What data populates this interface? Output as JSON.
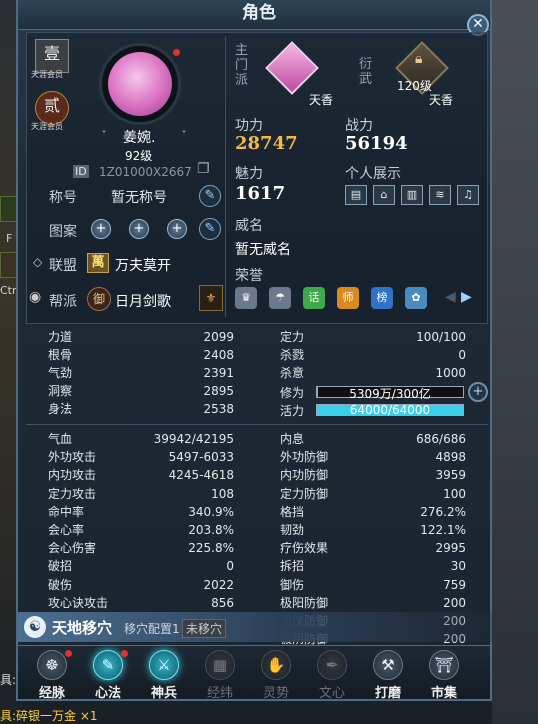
{
  "window": {
    "title": "角色"
  },
  "profile": {
    "seal1_glyph": "壹",
    "seal1_sub": "天涯会员",
    "seal2_glyph": "贰",
    "seal2_sub": "天涯会员",
    "name": "姜婉.",
    "level": "92级",
    "id_badge": "ID",
    "id": "1Z01000X2667"
  },
  "school": {
    "main_label": "主门派",
    "main_name": "天香",
    "yan_label": "衍武",
    "yan_level": "120级",
    "yan_name": "天香"
  },
  "summary": {
    "gongli_label": "功力",
    "gongli": "28747",
    "zhanli_label": "战力",
    "zhanli": "56194",
    "meili_label": "魅力",
    "meili": "1617",
    "showcase_label": "个人展示",
    "showcase_icons": [
      "id-card-icon",
      "house-icon",
      "palace-icon",
      "bird-icon",
      "bell-icon"
    ],
    "weiming_label": "威名",
    "weiming": "暂无威名",
    "rongyu_label": "荣誉",
    "honor_icons": [
      {
        "name": "hat-icon",
        "glyph": "♛",
        "color": "#6a7a8c"
      },
      {
        "name": "umbrella-icon",
        "glyph": "☂",
        "color": "#6a7a8c"
      },
      {
        "name": "hua-icon",
        "glyph": "话",
        "color": "#3ea84a"
      },
      {
        "name": "shi-icon",
        "glyph": "师",
        "color": "#d88a1e"
      },
      {
        "name": "bang-icon",
        "glyph": "榜",
        "color": "#2f72c8"
      },
      {
        "name": "flower-icon",
        "glyph": "✿",
        "color": "#4a8abf"
      }
    ]
  },
  "left_info": {
    "title_label": "称号",
    "title_value": "暂无称号",
    "pattern_label": "图案",
    "alliance_label": "联盟",
    "alliance_badge": "萬",
    "alliance_value": "万夫莫开",
    "guild_label": "帮派",
    "guild_badge": "御",
    "guild_value": "日月剑歌"
  },
  "stats_left_1": [
    {
      "label": "力道",
      "value": "2099"
    },
    {
      "label": "根骨",
      "value": "2408"
    },
    {
      "label": "气劲",
      "value": "2391"
    },
    {
      "label": "洞察",
      "value": "2895"
    },
    {
      "label": "身法",
      "value": "2538"
    }
  ],
  "stats_right_1": [
    {
      "label": "定力",
      "value": "100/100"
    },
    {
      "label": "杀戮",
      "value": "0"
    },
    {
      "label": "杀意",
      "value": "1000"
    }
  ],
  "bars": {
    "xiuwei_label": "修为",
    "xiuwei_text": "5309万/300亿",
    "xiuwei_fraction": 0.0018,
    "huoli_label": "活力",
    "huoli_text": "64000/64000",
    "huoli_fraction": 1.0
  },
  "stats_left_2": [
    {
      "label": "气血",
      "value": "39942/42195"
    },
    {
      "label": "外功攻击",
      "value": "5497-6033"
    },
    {
      "label": "内功攻击",
      "value": "4245-4618"
    },
    {
      "label": "定力攻击",
      "value": "108"
    },
    {
      "label": "命中率",
      "value": "340.9%"
    },
    {
      "label": "会心率",
      "value": "203.8%"
    },
    {
      "label": "会心伤害",
      "value": "225.8%"
    },
    {
      "label": "破招",
      "value": "0"
    },
    {
      "label": "破伤",
      "value": "2022"
    },
    {
      "label": "攻心诀攻击",
      "value": "856"
    }
  ],
  "stats_right_2": [
    {
      "label": "内息",
      "value": "686/686"
    },
    {
      "label": "外功防御",
      "value": "4898"
    },
    {
      "label": "内功防御",
      "value": "3959"
    },
    {
      "label": "定力防御",
      "value": "100"
    },
    {
      "label": "格挡",
      "value": "276.2%"
    },
    {
      "label": "韧劲",
      "value": "122.1%"
    },
    {
      "label": "疗伤效果",
      "value": "2995"
    },
    {
      "label": "拆招",
      "value": "30"
    },
    {
      "label": "御伤",
      "value": "759"
    },
    {
      "label": "极阳防御",
      "value": "200"
    },
    {
      "label": "两仪防御",
      "value": "200"
    },
    {
      "label": "极阴防御",
      "value": "200"
    }
  ],
  "move": {
    "title": "天地移穴",
    "config": "移穴配置1",
    "status": "未移穴"
  },
  "nav": [
    {
      "label": "经脉",
      "icon": "meridian-icon",
      "glyph": "☸",
      "state": "normal",
      "dot": true
    },
    {
      "label": "心法",
      "icon": "book-icon",
      "glyph": "✎",
      "state": "active",
      "dot": true
    },
    {
      "label": "神兵",
      "icon": "weapon-icon",
      "glyph": "⚔",
      "state": "active",
      "dot": false
    },
    {
      "label": "经纬",
      "icon": "grid-icon",
      "glyph": "▦",
      "state": "dim",
      "dot": false
    },
    {
      "label": "灵势",
      "icon": "hand-icon",
      "glyph": "✋",
      "state": "dim",
      "dot": false
    },
    {
      "label": "文心",
      "icon": "brush-icon",
      "glyph": "✒",
      "state": "dim",
      "dot": false
    },
    {
      "label": "打磨",
      "icon": "hammer-icon",
      "glyph": "⚒",
      "state": "normal",
      "dot": false
    },
    {
      "label": "市集",
      "icon": "market-icon",
      "glyph": "⛩",
      "state": "normal",
      "dot": false
    }
  ],
  "world": {
    "side_f": "F",
    "side_ctr": "Ctr",
    "chat_label": "具:",
    "chat_item": "具:碎银一万金 ×1"
  }
}
